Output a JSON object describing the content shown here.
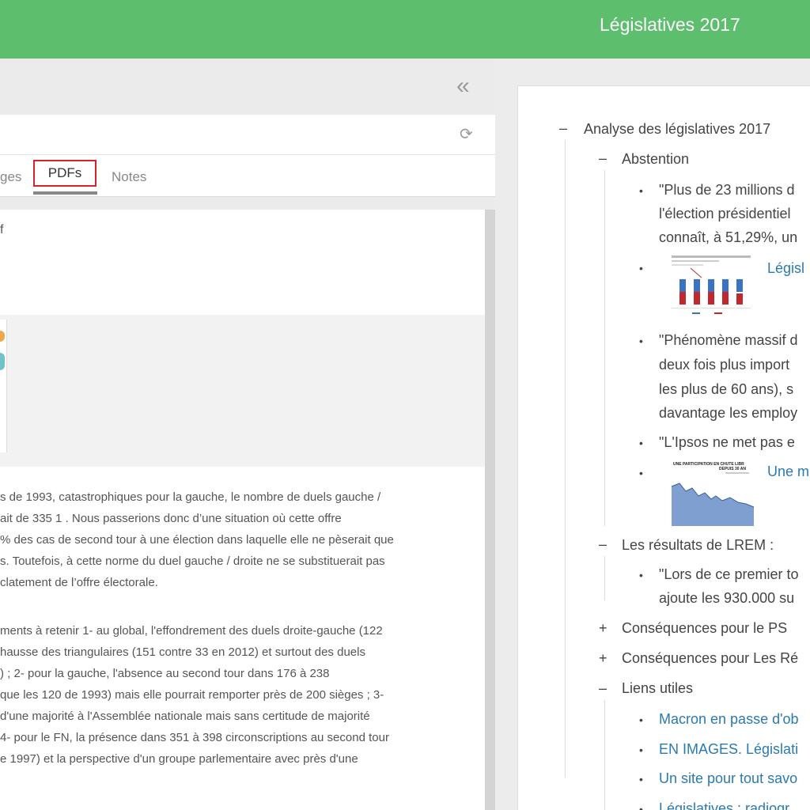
{
  "header": {
    "title": "Législatives 2017"
  },
  "left_panel": {
    "collapse_icon": "double-chevron-left-icon",
    "refresh_icon": "refresh-icon",
    "tabs": [
      {
        "label": "ges"
      },
      {
        "label": "PDFs"
      },
      {
        "label": "Notes"
      }
    ],
    "pdf_name": "f",
    "paragraph1": [
      "s de 1993, catastrophiques pour la gauche, le nombre de duels gauche /",
      "ait de 335 1 . Nous passerions donc d’une situation où cette offre",
      "% des cas de second tour à une élection dans laquelle elle ne pèserait que",
      "s. Toutefois, à cette norme du duel gauche / droite ne se substituerait pas",
      "clatement de l’offre électorale."
    ],
    "paragraph2": [
      "ments à retenir 1- au global, l'effondrement des duels droite-gauche (122",
      "hausse des triangulaires (151 contre 33 en 2012) et surtout des duels",
      ") ; 2- pour la gauche, l'absence au second tour dans 176 à 238",
      "que les 120 de 1993) mais elle pourrait remporter près de 200 sièges ; 3-",
      "d'une majorité à l'Assemblée nationale mais sans certitude de majorité",
      "4- pour le FN, la présence dans 351 à 398 circonscriptions au second tour",
      "e 1997) et la perspective d'un groupe parlementaire avec près d'une"
    ]
  },
  "mindmap": {
    "root": {
      "symbol": "–",
      "label": "Analyse des législatives 2017"
    },
    "abstention": {
      "symbol": "–",
      "label": "Abstention",
      "items": [
        {
          "lines": [
            "\"Plus de 23 millions d",
            "l'élection présidentiel",
            "connaît, à 51,29%, un"
          ]
        },
        {
          "link": "Législ"
        },
        {
          "lines": [
            "\"Phénomène massif d",
            "deux fois plus import",
            "les plus de 60 ans), s",
            "davantage les employ"
          ]
        },
        {
          "lines": [
            "\"L'Ipsos ne met pas e"
          ]
        },
        {
          "link": "Une m",
          "image_title": [
            "UNE PARTICIPATION EN CHUTE LIBR",
            "DEPUIS 30 AN"
          ]
        }
      ]
    },
    "lrem": {
      "symbol": "–",
      "label": "Les résultats de LREM :",
      "lines": [
        "\"Lors de ce premier to",
        "ajoute les 930.000 su"
      ]
    },
    "ps": {
      "symbol": "+",
      "label": "Conséquences pour le PS"
    },
    "lr": {
      "symbol": "+",
      "label": "Conséquences pour Les Ré"
    },
    "liens": {
      "symbol": "–",
      "label": "Liens utiles",
      "links": [
        "Macron en passe d'ob",
        "EN IMAGES. Législati",
        "Un site pour tout savo",
        "Législatives : radiogr"
      ]
    },
    "bullet": "•",
    "colors": {
      "link": "#2a7ab0",
      "bar_blue": "#3a72c4",
      "bar_red": "#c0282d",
      "area_blue": "#7e9fd0"
    }
  }
}
